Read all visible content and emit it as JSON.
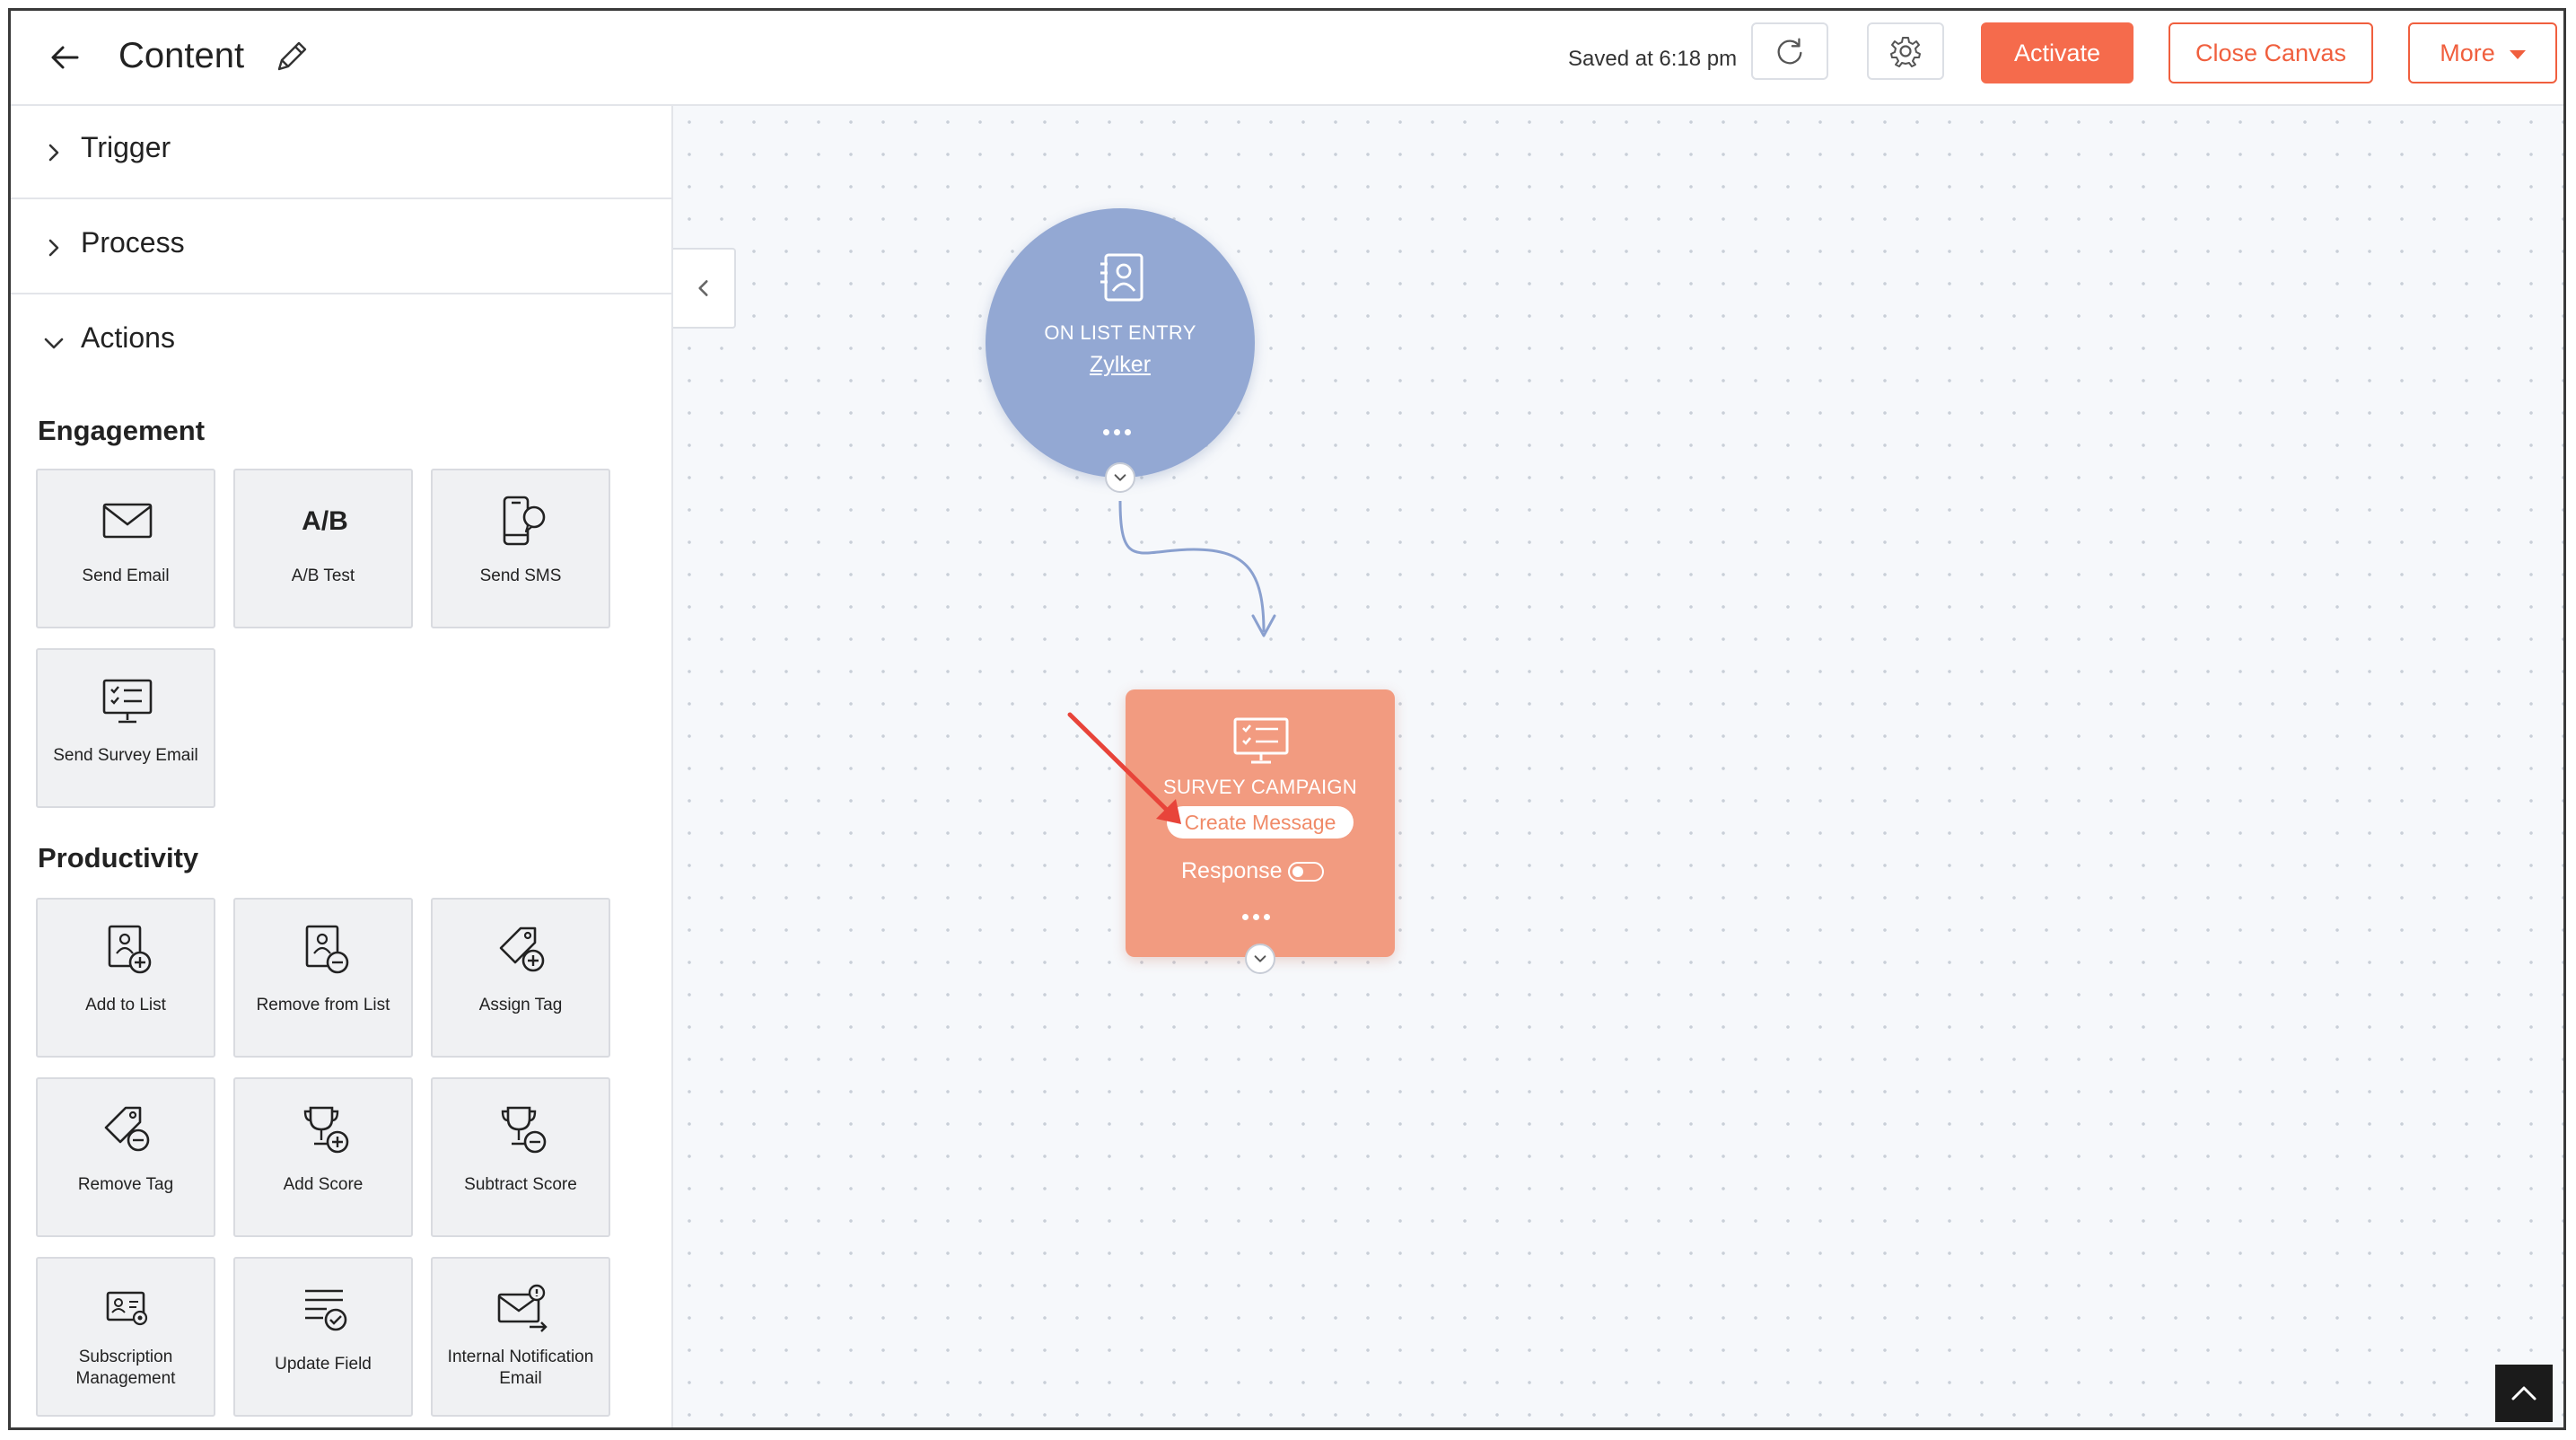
{
  "header": {
    "title": "Content",
    "saved_text": "Saved at 6:18 pm",
    "activate_label": "Activate",
    "close_canvas_label": "Close Canvas",
    "more_label": "More"
  },
  "sidebar": {
    "accordions": [
      {
        "label": "Trigger",
        "expanded": false
      },
      {
        "label": "Process",
        "expanded": false
      },
      {
        "label": "Actions",
        "expanded": true
      }
    ],
    "sections": {
      "engagement": {
        "title": "Engagement",
        "tiles": [
          {
            "label": "Send Email",
            "icon": "envelope-icon"
          },
          {
            "label": "A/B Test",
            "icon": "ab-test-icon",
            "icon_text": "A/B"
          },
          {
            "label": "Send SMS",
            "icon": "phone-sms-icon"
          },
          {
            "label": "Send Survey Email",
            "icon": "survey-monitor-icon"
          }
        ]
      },
      "productivity": {
        "title": "Productivity",
        "tiles": [
          {
            "label": "Add to List",
            "icon": "add-to-list-icon"
          },
          {
            "label": "Remove from List",
            "icon": "remove-from-list-icon"
          },
          {
            "label": "Assign Tag",
            "icon": "assign-tag-icon"
          },
          {
            "label": "Remove Tag",
            "icon": "remove-tag-icon"
          },
          {
            "label": "Add Score",
            "icon": "add-score-icon"
          },
          {
            "label": "Subtract Score",
            "icon": "subtract-score-icon"
          },
          {
            "label": "Subscription Management",
            "icon": "subscription-icon"
          },
          {
            "label": "Update Field",
            "icon": "update-field-icon"
          },
          {
            "label": "Internal Notification Email",
            "icon": "notification-email-icon"
          }
        ]
      }
    }
  },
  "canvas": {
    "entry_node": {
      "type_label": "ON LIST ENTRY",
      "link_label": "Zylker",
      "color": "#93a8d3"
    },
    "survey_node": {
      "type_label": "SURVEY CAMPAIGN",
      "create_message_label": "Create Message",
      "response_label": "Response",
      "response_enabled": false,
      "color": "#f29b80"
    }
  },
  "colors": {
    "accent": "#f56b4c",
    "annotation_arrow": "#e8443a"
  }
}
